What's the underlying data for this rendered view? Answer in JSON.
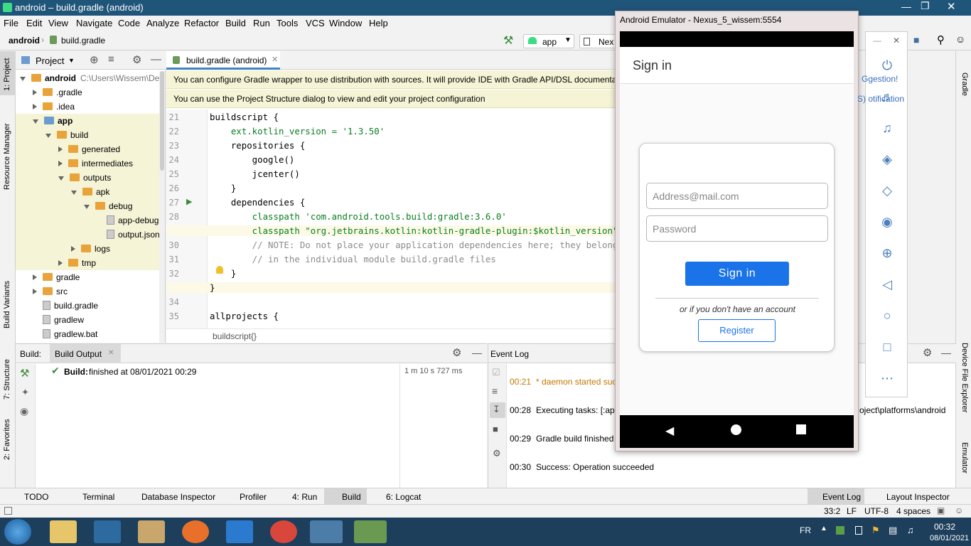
{
  "window": {
    "title": "android – build.gradle (android)"
  },
  "menu": [
    "File",
    "Edit",
    "View",
    "Navigate",
    "Code",
    "Analyze",
    "Refactor",
    "Build",
    "Run",
    "Tools",
    "VCS",
    "Window",
    "Help"
  ],
  "nav": {
    "project": "android",
    "file": "build.gradle",
    "config": "app",
    "device": "Nex"
  },
  "project_panel": {
    "title": "Project",
    "tree": [
      {
        "label": "android",
        "extra": "C:\\Users\\Wissem\\Deskt",
        "indent": 0,
        "bold": true,
        "arrow": "down",
        "kind": "folder"
      },
      {
        "label": ".gradle",
        "indent": 1,
        "arrow": "right",
        "kind": "folder"
      },
      {
        "label": ".idea",
        "indent": 1,
        "arrow": "right",
        "kind": "folder"
      },
      {
        "label": "app",
        "indent": 1,
        "bold": true,
        "arrow": "down",
        "kind": "folder-blue"
      },
      {
        "label": "build",
        "indent": 2,
        "arrow": "down",
        "kind": "folder"
      },
      {
        "label": "generated",
        "indent": 3,
        "arrow": "right",
        "kind": "folder"
      },
      {
        "label": "intermediates",
        "indent": 3,
        "arrow": "right",
        "kind": "folder"
      },
      {
        "label": "outputs",
        "indent": 3,
        "arrow": "down",
        "kind": "folder"
      },
      {
        "label": "apk",
        "indent": 4,
        "arrow": "down",
        "kind": "folder"
      },
      {
        "label": "debug",
        "indent": 5,
        "arrow": "down",
        "kind": "folder"
      },
      {
        "label": "app-debug.a",
        "indent": 6,
        "arrow": "none",
        "kind": "file"
      },
      {
        "label": "output.json",
        "indent": 6,
        "arrow": "none",
        "kind": "file"
      },
      {
        "label": "logs",
        "indent": 4,
        "arrow": "right",
        "kind": "folder"
      },
      {
        "label": "tmp",
        "indent": 3,
        "arrow": "right",
        "kind": "folder"
      },
      {
        "label": "gradle",
        "indent": 1,
        "arrow": "right",
        "kind": "folder"
      },
      {
        "label": "src",
        "indent": 1,
        "arrow": "right",
        "kind": "folder"
      },
      {
        "label": "build.gradle",
        "indent": 1,
        "arrow": "none",
        "kind": "file"
      },
      {
        "label": "gradlew",
        "indent": 1,
        "arrow": "none",
        "kind": "file"
      },
      {
        "label": "gradlew.bat",
        "indent": 1,
        "arrow": "none",
        "kind": "file"
      }
    ]
  },
  "left_stripe": [
    "1: Project",
    "Resource Manager",
    "Build Variants",
    "7: Structure",
    "2: Favorites"
  ],
  "right_stripe": [
    "Gradle",
    "Device File Explorer",
    "Emulator"
  ],
  "editor": {
    "tab": "build.gradle (android)",
    "banner1": "You can configure Gradle wrapper to use distribution with sources. It will provide IDE with Gradle API/DSL documentat",
    "banner1_right": "Ggestion!",
    "banner2": "You can use the Project Structure dialog to view and edit your project configuration",
    "banner2_right": "S) otification",
    "lines": [
      {
        "n": "21",
        "t": "buildscript {"
      },
      {
        "n": "22",
        "t": "    ext.kotlin_version = '1.3.50'"
      },
      {
        "n": "23",
        "t": "    repositories {"
      },
      {
        "n": "24",
        "t": "        google()"
      },
      {
        "n": "25",
        "t": "        jcenter()"
      },
      {
        "n": "26",
        "t": "    }"
      },
      {
        "n": "27",
        "t": "    dependencies {"
      },
      {
        "n": "28",
        "t": "        classpath 'com.android.tools.build:gradle:3.6.0'"
      },
      {
        "n": "29",
        "t": "        classpath \"org.jetbrains.kotlin:kotlin-gradle-plugin:$kotlin_version\""
      },
      {
        "n": "30",
        "t": "        // NOTE: Do not place your application dependencies here; they belong"
      },
      {
        "n": "31",
        "t": "        // in the individual module build.gradle files"
      },
      {
        "n": "32",
        "t": "    }"
      },
      {
        "n": "33",
        "t": "}"
      },
      {
        "n": "34",
        "t": ""
      },
      {
        "n": "35",
        "t": "allprojects {"
      }
    ],
    "breadcrumb": "buildscript{}"
  },
  "build_panel": {
    "label": "Build:",
    "tab": "Build Output",
    "result_bold": "Build:",
    "result": "finished at 08/01/2021 00:29",
    "time": "1 m 10 s 727 ms"
  },
  "event_log": {
    "title": "Event Log",
    "entries": [
      {
        "time": "00:21",
        "text": "* daemon started suc",
        "warn": true
      },
      {
        "time": "00:28",
        "text": "Executing tasks: [:app",
        "tail": "oject\\platforms\\android"
      },
      {
        "time": "00:29",
        "text": "Gradle build finished"
      },
      {
        "time": "00:30",
        "text": "Success: Operation succeeded"
      }
    ]
  },
  "bottom_tools": [
    "TODO",
    "Terminal",
    "Database Inspector",
    "Profiler",
    "4: Run",
    "Build",
    "6: Logcat"
  ],
  "bottom_tools_right": [
    "Event Log",
    "Layout Inspector"
  ],
  "status": {
    "pos": "33:2",
    "le": "LF",
    "enc": "UTF-8",
    "indent": "4 spaces"
  },
  "emulator": {
    "title": "Android Emulator - Nexus_5_wissem:5554",
    "app_title": "Sign in",
    "email_placeholder": "Address@mail.com",
    "password_placeholder": "Password",
    "signin": "Sign in",
    "or_text": "or if you don't have an account",
    "register": "Register",
    "accent": "#1a73e8"
  },
  "taskbar": {
    "lang": "FR",
    "time": "00:32",
    "date": "08/01/2021"
  }
}
